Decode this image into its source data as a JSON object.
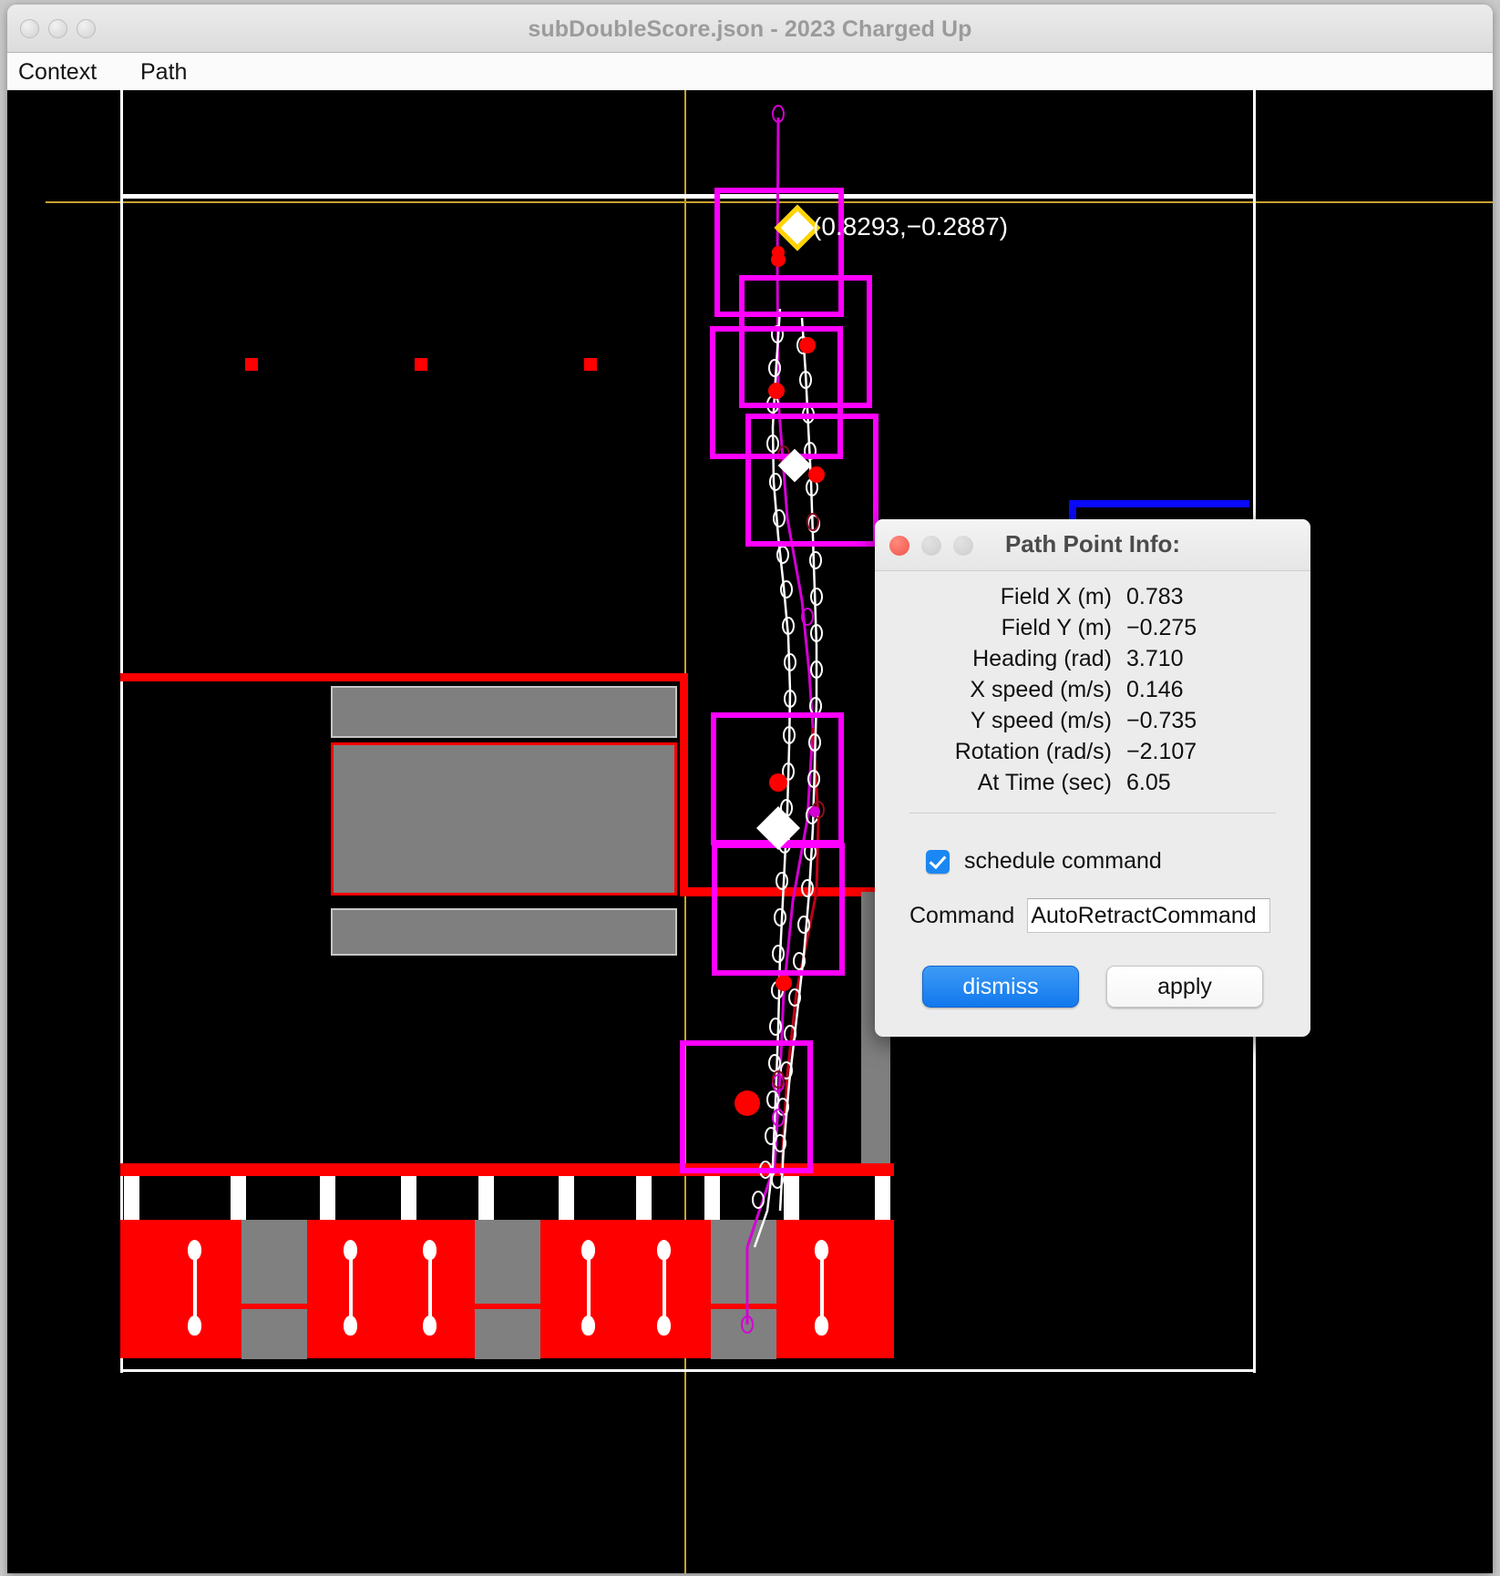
{
  "window": {
    "title": "subDoubleScore.json - 2023 Charged Up",
    "traffic_lights": [
      "close",
      "minimize",
      "zoom"
    ]
  },
  "menubar": {
    "items": [
      {
        "label": "Context"
      },
      {
        "label": "Path"
      }
    ]
  },
  "field": {
    "coordinate_label": "(0.8293,−0.2887)",
    "background_color": "#000000",
    "alliance_red_color": "#ff0000",
    "alliance_blue_color": "#0a0aff",
    "path_outline_color": "#ff00ff",
    "waypoint_color": "#ff0000",
    "guideline_color": "#c8a22c"
  },
  "dialog": {
    "title": "Path Point Info:",
    "traffic_lights": [
      "close",
      "minimize",
      "zoom"
    ],
    "rows": [
      {
        "label": "Field X (m)",
        "value": "0.783"
      },
      {
        "label": "Field Y (m)",
        "value": "−0.275"
      },
      {
        "label": "Heading (rad)",
        "value": "3.710"
      },
      {
        "label": "X speed (m/s)",
        "value": "0.146"
      },
      {
        "label": "Y speed (m/s)",
        "value": "−0.735"
      },
      {
        "label": "Rotation (rad/s)",
        "value": "−2.107"
      },
      {
        "label": "At Time (sec)",
        "value": "6.05"
      }
    ],
    "schedule_command": {
      "label": "schedule command",
      "checked": true,
      "accent_color": "#1a87f2"
    },
    "command": {
      "label": "Command",
      "value": "AutoRetractCommand"
    },
    "buttons": [
      {
        "label": "dismiss",
        "style": "primary"
      },
      {
        "label": "apply",
        "style": "default"
      }
    ]
  }
}
